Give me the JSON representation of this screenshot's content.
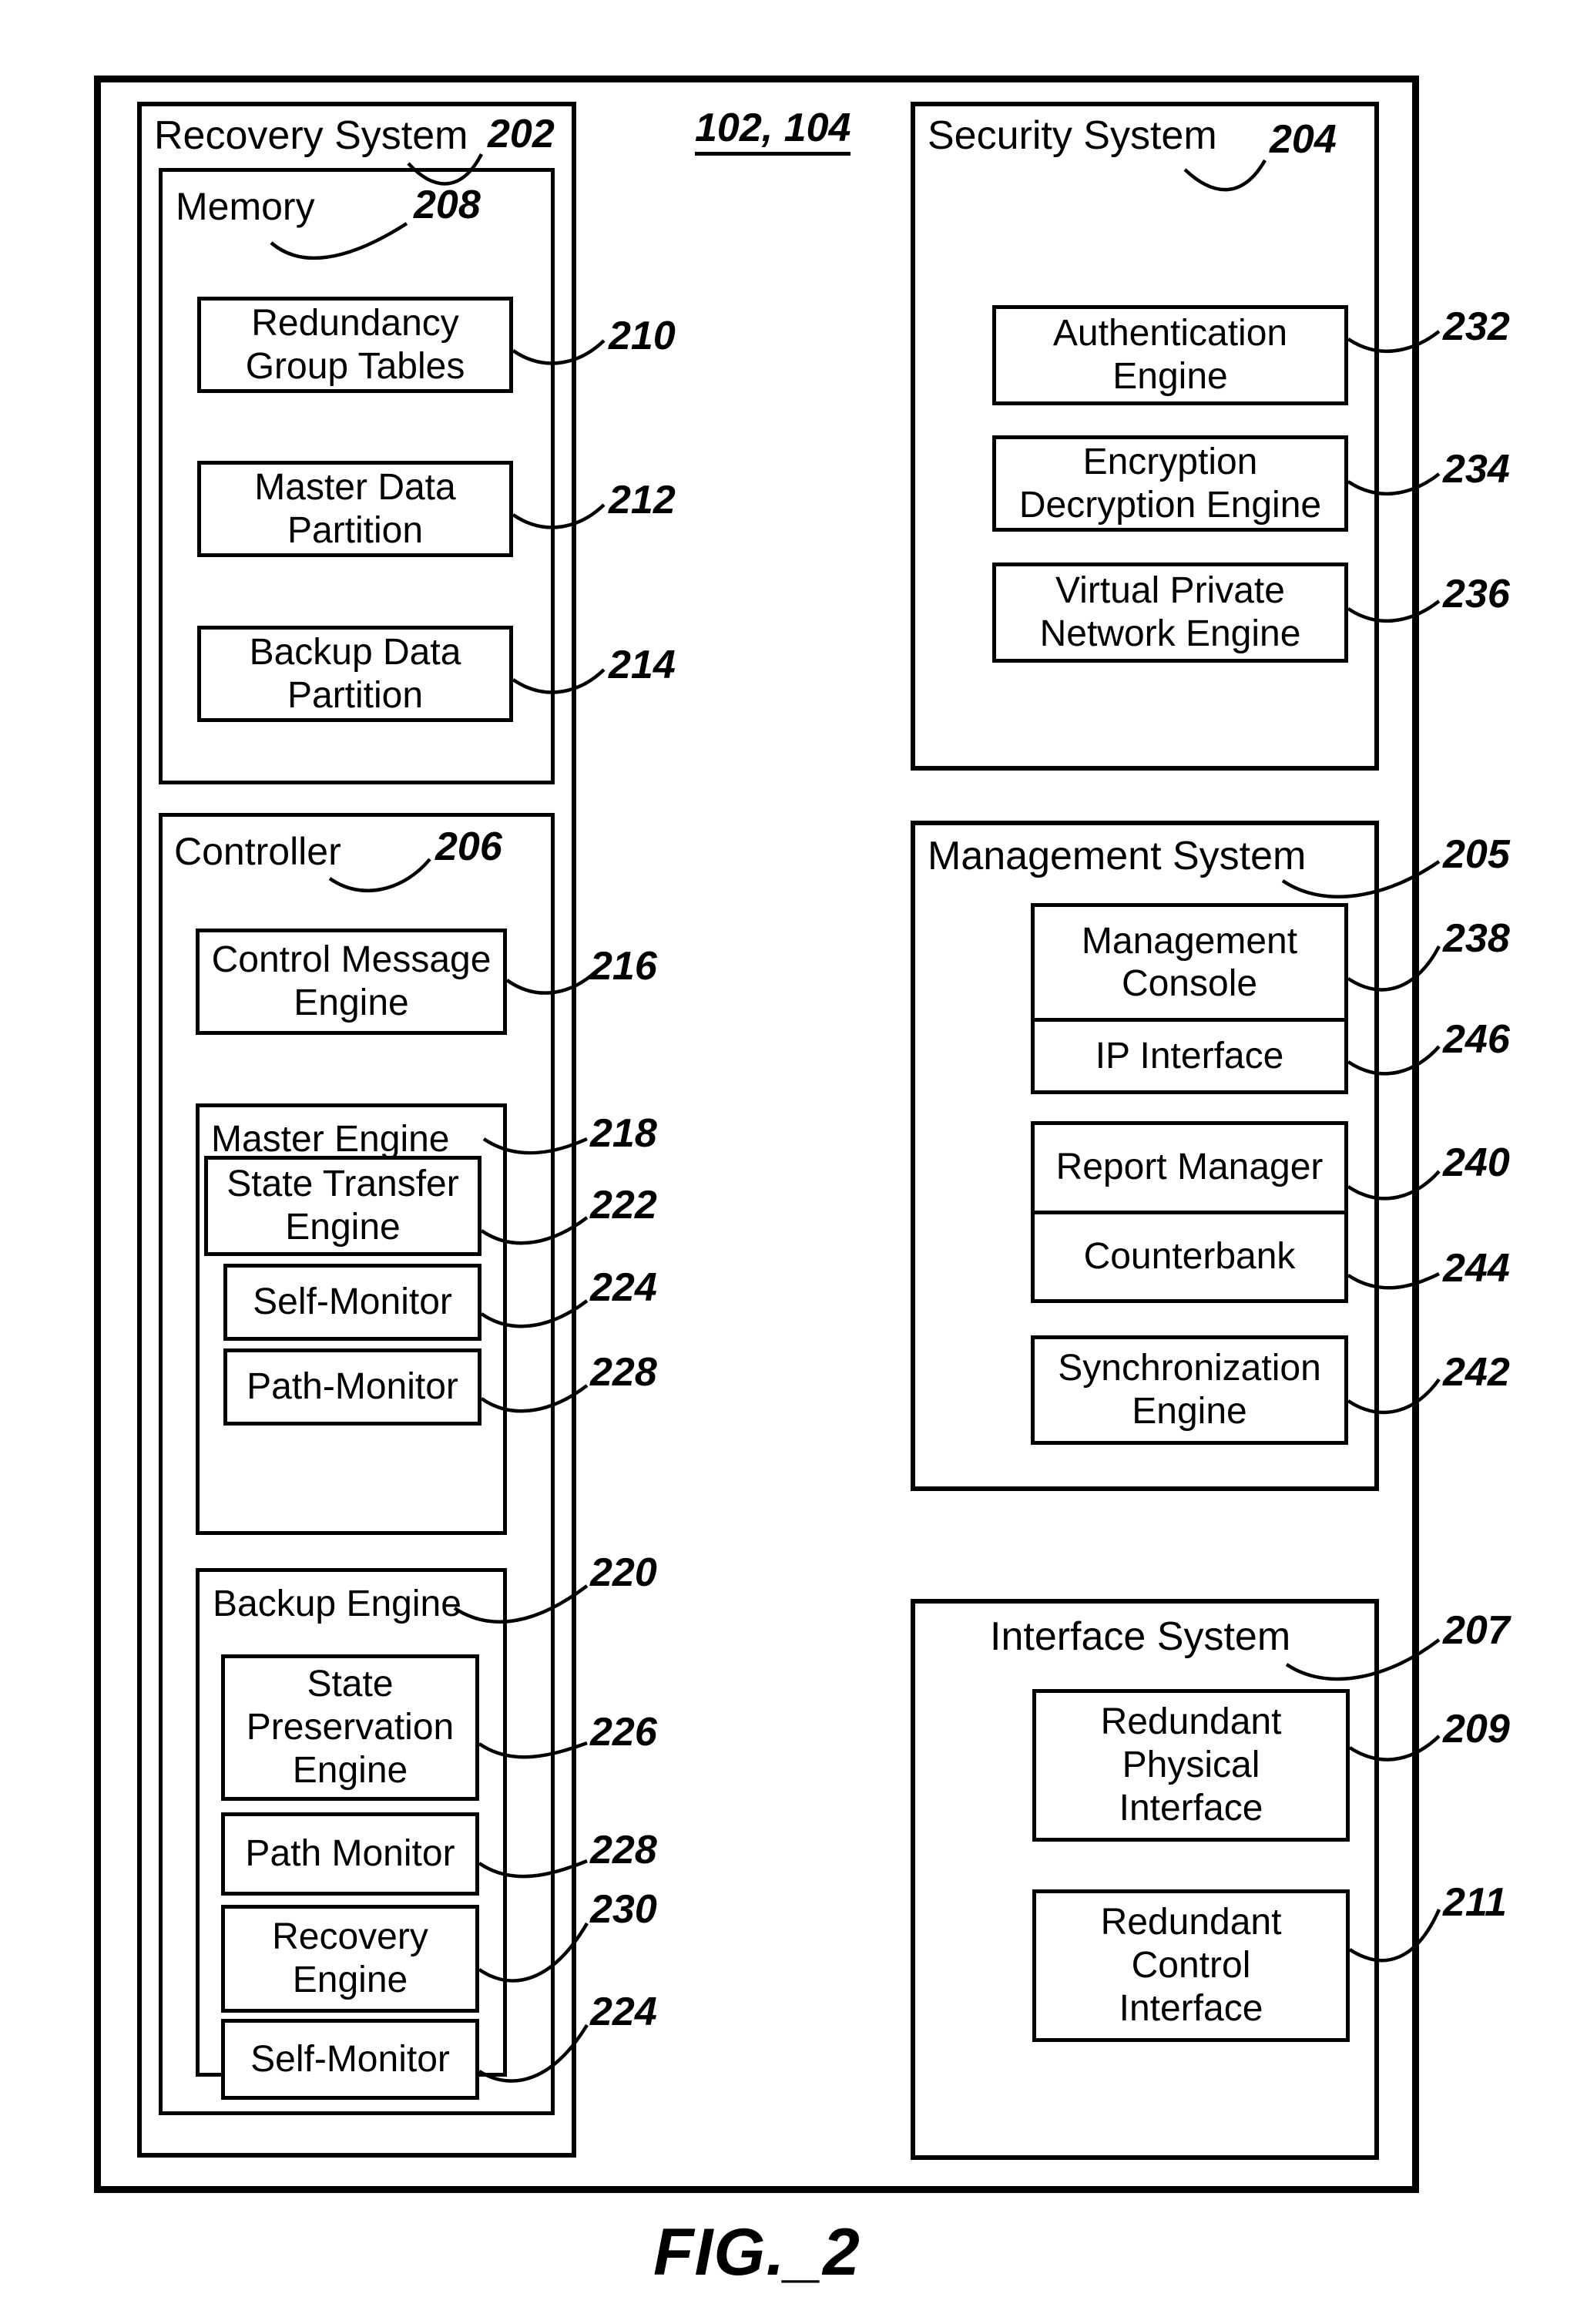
{
  "figure": {
    "caption": "FIG._2",
    "system_ref": "102, 104"
  },
  "recovery_system": {
    "title": "Recovery System",
    "ref": "202",
    "memory": {
      "title": "Memory",
      "ref": "208",
      "items": [
        {
          "label": "Redundancy\nGroup Tables",
          "ref": "210"
        },
        {
          "label": "Master Data\nPartition",
          "ref": "212"
        },
        {
          "label": "Backup Data\nPartition",
          "ref": "214"
        }
      ]
    },
    "controller": {
      "title": "Controller",
      "ref": "206",
      "control_message_engine": {
        "label": "Control Message\nEngine",
        "ref": "216"
      },
      "master_engine": {
        "title": "Master Engine",
        "ref": "218",
        "items": [
          {
            "label": "State  Transfer\nEngine",
            "ref": "222"
          },
          {
            "label": "Self-Monitor",
            "ref": "224"
          },
          {
            "label": "Path-Monitor",
            "ref": "228"
          }
        ]
      },
      "backup_engine": {
        "title": "Backup Engine",
        "ref": "220",
        "items": [
          {
            "label": "State\nPreservation\nEngine",
            "ref": "226"
          },
          {
            "label": "Path Monitor",
            "ref": "228"
          },
          {
            "label": "Recovery\nEngine",
            "ref": "230"
          },
          {
            "label": "Self-Monitor",
            "ref": "224"
          }
        ]
      }
    }
  },
  "security_system": {
    "title": "Security System",
    "ref": "204",
    "items": [
      {
        "label": "Authentication\nEngine",
        "ref": "232"
      },
      {
        "label": "Encryption\nDecryption Engine",
        "ref": "234"
      },
      {
        "label": "Virtual Private\nNetwork Engine",
        "ref": "236"
      }
    ]
  },
  "management_system": {
    "title": "Management System",
    "ref": "205",
    "group_console": [
      {
        "label": "Management\nConsole",
        "ref": "238"
      },
      {
        "label": "IP Interface",
        "ref": "246"
      }
    ],
    "group_report": [
      {
        "label": "Report Manager",
        "ref": "240"
      },
      {
        "label": "Counterbank",
        "ref": "244"
      }
    ],
    "sync_engine": {
      "label": "Synchronization\nEngine",
      "ref": "242"
    }
  },
  "interface_system": {
    "title": "Interface System",
    "ref": "207",
    "items": [
      {
        "label": "Redundant\nPhysical\nInterface",
        "ref": "209"
      },
      {
        "label": "Redundant\nControl\nInterface",
        "ref": "211"
      }
    ]
  }
}
